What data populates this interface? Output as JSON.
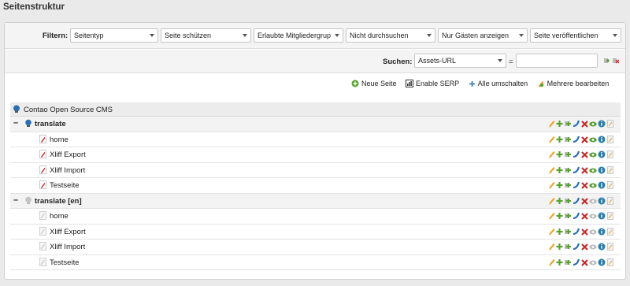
{
  "page": {
    "title": "Seitenstruktur"
  },
  "filter": {
    "label": "Filtern:",
    "selects": [
      {
        "value": "Seitentyp"
      },
      {
        "value": "Seite schützen"
      },
      {
        "value": "Erlaubte Mitgliedergrup"
      },
      {
        "value": "Nicht durchsuchen"
      },
      {
        "value": "Nur Gästen anzeigen"
      },
      {
        "value": "Seite veröffentlichen"
      }
    ]
  },
  "search": {
    "label": "Suchen:",
    "field_value": "Assets-URL",
    "eq": "=",
    "query": ""
  },
  "global_operations": [
    {
      "label": "Neue Seite",
      "icon": "new-page-icon"
    },
    {
      "label": "Enable SERP",
      "icon": "serp-icon"
    },
    {
      "label": "Alle umschalten",
      "icon": "toggle-all-icon"
    },
    {
      "label": "Mehrere bearbeiten",
      "icon": "edit-multiple-icon"
    }
  ],
  "tree": {
    "root": {
      "label": "Contao Open Source CMS"
    },
    "groups": [
      {
        "label": "translate",
        "published": true,
        "pages": [
          {
            "label": "home"
          },
          {
            "label": "Xliff Export"
          },
          {
            "label": "Xliff Import"
          },
          {
            "label": "Testseite"
          }
        ]
      },
      {
        "label": "translate [en]",
        "published": false,
        "pages": [
          {
            "label": "home"
          },
          {
            "label": "Xliff Export"
          },
          {
            "label": "Xliff Import"
          },
          {
            "label": "Testseite"
          }
        ]
      }
    ]
  },
  "colors": {
    "green": "#5aa22f",
    "orange": "#f0a02b",
    "red": "#c52c2c",
    "blue": "#2a6fb0",
    "teal": "#2a7ea8"
  }
}
